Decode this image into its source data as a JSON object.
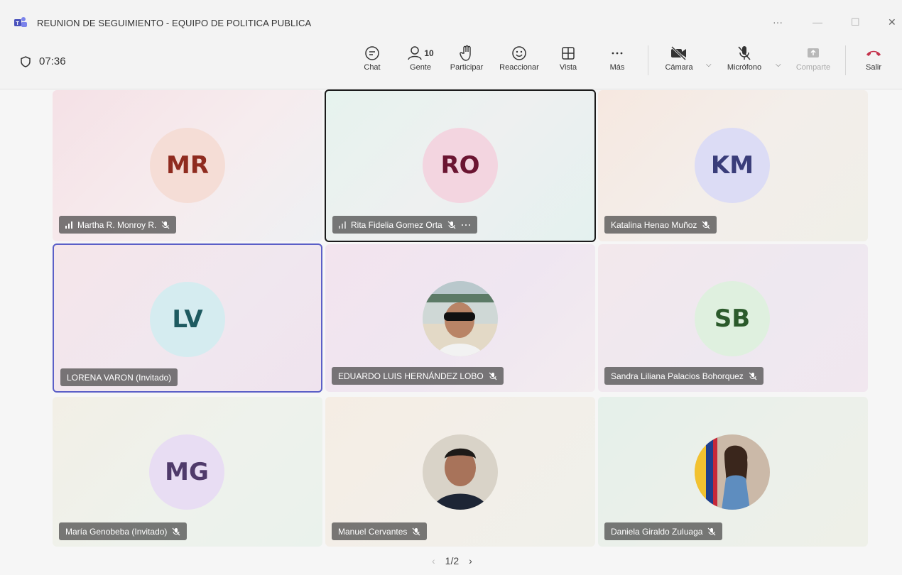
{
  "window": {
    "title": "REUNION DE SEGUIMIENTO - EQUIPO DE POLITICA PUBLICA",
    "more": "···",
    "minimize": "—",
    "maximize": "☐",
    "close": "✕"
  },
  "toolbar": {
    "timer": "07:36",
    "chat": "Chat",
    "people": "Gente",
    "people_count": "10",
    "raise": "Participar",
    "react": "Reaccionar",
    "view": "Vista",
    "more": "Más",
    "camera": "Cámara",
    "mic": "Micrófono",
    "share": "Comparte",
    "leave": "Salir"
  },
  "tiles": [
    {
      "initials": "MR",
      "name": "Martha R. Monroy R.",
      "avatar_bg": "#f5ddd6",
      "avatar_fg": "#8f2b1f"
    },
    {
      "initials": "RO",
      "name": "Rita Fidelia Gomez Orta",
      "avatar_bg": "#f3d5e0",
      "avatar_fg": "#6b1532"
    },
    {
      "initials": "KM",
      "name": "Katalina Henao Muñoz",
      "avatar_bg": "#dcdcf5",
      "avatar_fg": "#3a3d7a"
    },
    {
      "initials": "LV",
      "name": "LORENA VARON (Invitado)",
      "avatar_bg": "#d5ecf0",
      "avatar_fg": "#1d5a60"
    },
    {
      "initials": "",
      "name": "EDUARDO LUIS HERNÁNDEZ LOBO"
    },
    {
      "initials": "SB",
      "name": "Sandra Liliana Palacios Bohorquez",
      "avatar_bg": "#dff0df",
      "avatar_fg": "#2b5a2b"
    },
    {
      "initials": "MG",
      "name": "María Genobeba (Invitado)",
      "avatar_bg": "#e8ddf3",
      "avatar_fg": "#4f3a6a"
    },
    {
      "initials": "",
      "name": "Manuel Cervantes"
    },
    {
      "initials": "",
      "name": "Daniela Giraldo Zuluaga"
    }
  ],
  "pager": {
    "prev": "‹",
    "label": "1/2",
    "next": "›"
  }
}
